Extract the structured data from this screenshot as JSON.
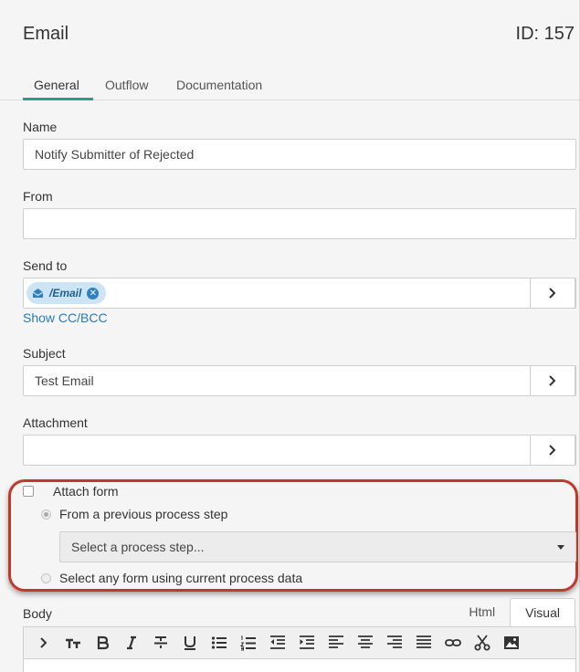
{
  "header": {
    "title": "Email",
    "id_label": "ID: 157"
  },
  "tabs": [
    {
      "label": "General",
      "active": true
    },
    {
      "label": "Outflow",
      "active": false
    },
    {
      "label": "Documentation",
      "active": false
    }
  ],
  "form": {
    "name": {
      "label": "Name",
      "value": "Notify Submitter of Rejected"
    },
    "from": {
      "label": "From",
      "value": ""
    },
    "send_to": {
      "label": "Send to",
      "tag": "/Email",
      "tag_icon": "envelope-icon"
    },
    "show_cc_bcc": "Show CC/BCC",
    "subject": {
      "label": "Subject",
      "value": "Test Email"
    },
    "attachment": {
      "label": "Attachment",
      "value": ""
    },
    "attach_form": {
      "label": "Attach form",
      "checked": false,
      "option_previous": "From a previous process step",
      "select_placeholder": "Select a process step...",
      "option_any": "Select any form using current process data"
    },
    "body": {
      "label": "Body",
      "tabs": [
        {
          "label": "Html",
          "active": false
        },
        {
          "label": "Visual",
          "active": true
        }
      ],
      "toolbar": [
        "chevron-right-icon",
        "text-size-icon",
        "bold-icon",
        "italic-icon",
        "strikethrough-icon",
        "underline-icon",
        "bullet-list-icon",
        "numbered-list-icon",
        "outdent-icon",
        "indent-icon",
        "align-left-icon",
        "align-center-icon",
        "align-right-icon",
        "justify-icon",
        "link-icon",
        "cut-icon",
        "image-icon"
      ]
    }
  },
  "colors": {
    "accent": "#2a9d8f",
    "highlight_border": "#c0392b",
    "link": "#2a7ab8",
    "tag_bg": "#cde4f4"
  }
}
